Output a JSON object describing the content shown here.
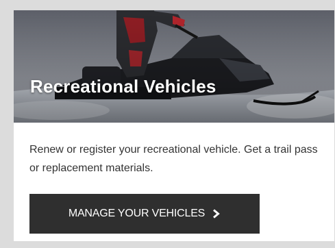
{
  "card": {
    "hero": {
      "title": "Recreational Vehicles",
      "image": "snowmobile-rider-in-snow-photo"
    },
    "description": "Renew or register your recreational vehicle. Get a trail pass or replacement materials.",
    "button": {
      "label": "MANAGE YOUR VEHICLES",
      "icon": "chevron-right-icon"
    }
  },
  "colors": {
    "page_background": "#dcdcdc",
    "card_background": "#ffffff",
    "button_background": "#2f2f2f",
    "button_text": "#ffffff",
    "body_text": "#333333"
  }
}
